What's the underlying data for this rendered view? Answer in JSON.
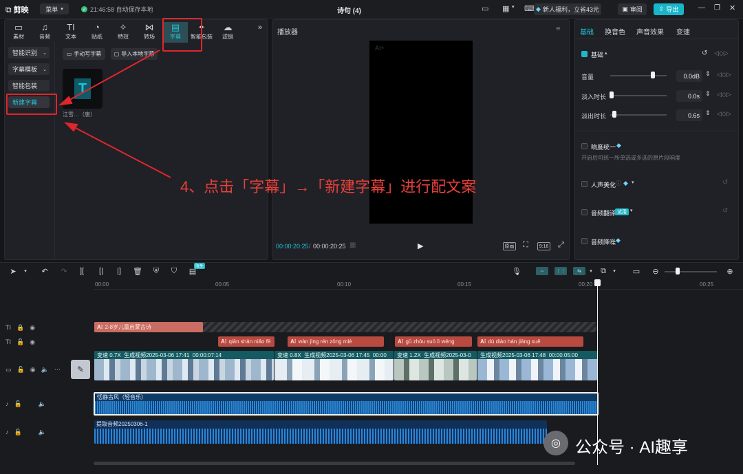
{
  "topbar": {
    "logo": "剪映",
    "menu": "菜单",
    "autosave": "21:46:58 自动保存本地",
    "title": "诗句 (4)",
    "promo": "新人福利，立省43元",
    "review": "审阅",
    "export": "导出"
  },
  "media_tabs": [
    {
      "label": "素材",
      "icon": "▭"
    },
    {
      "label": "音频",
      "icon": "♫"
    },
    {
      "label": "文本",
      "icon": "TI"
    },
    {
      "label": "贴纸",
      "icon": "◔"
    },
    {
      "label": "特效",
      "icon": "✧"
    },
    {
      "label": "转场",
      "icon": "⋈"
    },
    {
      "label": "字幕",
      "icon": "▤"
    },
    {
      "label": "智能包装",
      "icon": "✦"
    },
    {
      "label": "滤镜",
      "icon": "☁"
    }
  ],
  "sidebar": {
    "items": [
      "智能识别",
      "字幕模板",
      "智能包装",
      "新建字幕"
    ]
  },
  "content": {
    "manual_button": "手动写字幕",
    "import_button": "导入本地字幕",
    "thumb_caption": "江雪…（唐）",
    "thumb_letter": "T"
  },
  "annotation": "4、点击「字幕」→「新建字幕」进行配文案",
  "player": {
    "title": "播放器",
    "current_time": "00:00:20:25",
    "total_time": "00:00:20:25",
    "original_label": "原画",
    "ratio_label": "9:16",
    "watermark": "AI+"
  },
  "inspector": {
    "tabs": [
      "基础",
      "换音色",
      "声音效果",
      "变速"
    ],
    "basic_label": "基础",
    "volume_label": "音量",
    "volume_value": "0.0dB",
    "volume_level": 0.75,
    "fadein_label": "淡入时长",
    "fadein_value": "0.0s",
    "fadeout_label": "淡出时长",
    "fadeout_value": "0.6s",
    "loudness_label": "响度统一",
    "loudness_desc": "开启后可统一所单选或多选的原片段响度",
    "voice_beauty": "人声美化",
    "translate": "音频翻译",
    "trial": "试用",
    "denoise": "音频降噪"
  },
  "timeline": {
    "ruler": [
      "00:00",
      "00:05",
      "00:10",
      "00:15",
      "00:20",
      "00:25"
    ],
    "free_badge": "限免",
    "text_track_clip": "2-8岁儿童启蒙古诗",
    "subtitle_clips": [
      "qiān  shān  niǎo  fē",
      "wàn  jìng  rén  zōng  miè",
      "gū  zhōu  suō  lì  wēng",
      "dú  diào  hán  jiāng  xuě"
    ],
    "video_clips": [
      {
        "speed": "变速 0.7X",
        "name": "生成视频2025-03-06 17:41",
        "dur": "00:00:07:14"
      },
      {
        "speed": "变速 0.8X",
        "name": "生成视频2025-03-06 17:45",
        "dur": "00:00"
      },
      {
        "speed": "变速 1.2X",
        "name": "生成视频2025-03-0",
        "dur": ""
      },
      {
        "speed": "",
        "name": "生成视频2025-03-06 17:48",
        "dur": "00:00:05:00"
      }
    ],
    "music_clip": "恬静古风（轻音乐）",
    "extract_clip": "提取音频20250306-1"
  },
  "watermark_text": "公众号 · AI趣享",
  "colors": {
    "accent": "#1fc3d6",
    "red": "#e0262c",
    "export": "#19b6c9"
  }
}
